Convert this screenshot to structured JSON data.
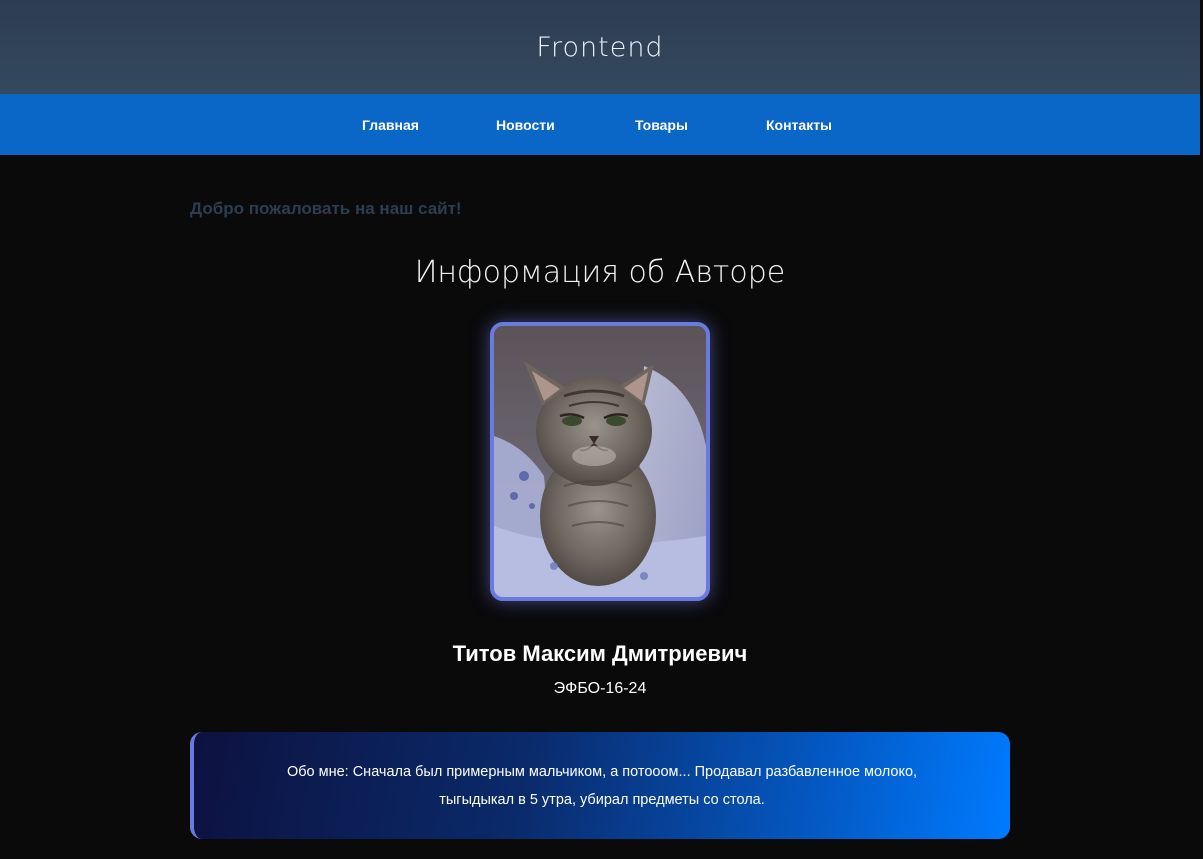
{
  "header": {
    "title": "Frontend"
  },
  "nav": {
    "items": [
      {
        "label": "Главная"
      },
      {
        "label": "Новости"
      },
      {
        "label": "Товары"
      },
      {
        "label": "Контакты"
      }
    ]
  },
  "main": {
    "welcome": "Добро пожаловать на наш сайт!",
    "section_title": "Информация об Авторе",
    "author": {
      "photo_icon": "kitten-photo",
      "name": "Титов Максим Дмитриевич",
      "group": "ЭФБО-16-24"
    },
    "about": {
      "line1": "Обо мне: Сначала был примерным мальчиком, а потоoом... Продавал разбавленное молоко,",
      "line2": "тыгыдыкал в 5 утра, убирал предметы со стола."
    }
  },
  "colors": {
    "header_bg": "#34495e",
    "nav_bg": "#0a67c8",
    "page_bg": "#0a0a0b",
    "welcome_text": "#2c3e50",
    "photo_border": "#6c7ae0",
    "about_gradient_start": "#0d1240",
    "about_gradient_end": "#007bff"
  }
}
